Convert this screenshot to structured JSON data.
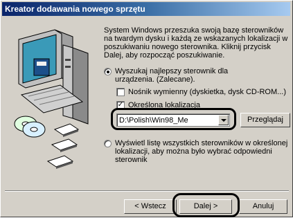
{
  "window": {
    "title": "Kreator dodawania nowego sprzętu"
  },
  "intro": "System Windows przeszuka swoją bazę sterowników na twardym dysku i każdą ze wskazanych lokalizacji w poszukiwaniu nowego sterownika. Kliknij przycisk Dalej, aby rozpocząć poszukiwanie.",
  "option_search": {
    "label": "Wyszukaj najlepszy sterownik dla urządzenia. (Zalecane).",
    "selected": true
  },
  "check_removable": {
    "label": "Nośnik wymienny (dyskietka, dysk CD-ROM...)",
    "checked": false
  },
  "check_location": {
    "label": "Określona lokalizacja",
    "checked": true
  },
  "location_combo": {
    "value": "D:\\Polish\\Win98_Me"
  },
  "browse_button": "Przeglądaj",
  "option_list": {
    "label": "Wyświetl listę wszystkich sterowników w określonej lokalizacji, aby można było wybrać odpowiedni sterownik",
    "selected": false
  },
  "buttons": {
    "back": "< Wstecz",
    "next": "Dalej >",
    "cancel": "Anuluj"
  },
  "colors": {
    "titlebar": "#0a246a",
    "face": "#d4d0c8"
  }
}
